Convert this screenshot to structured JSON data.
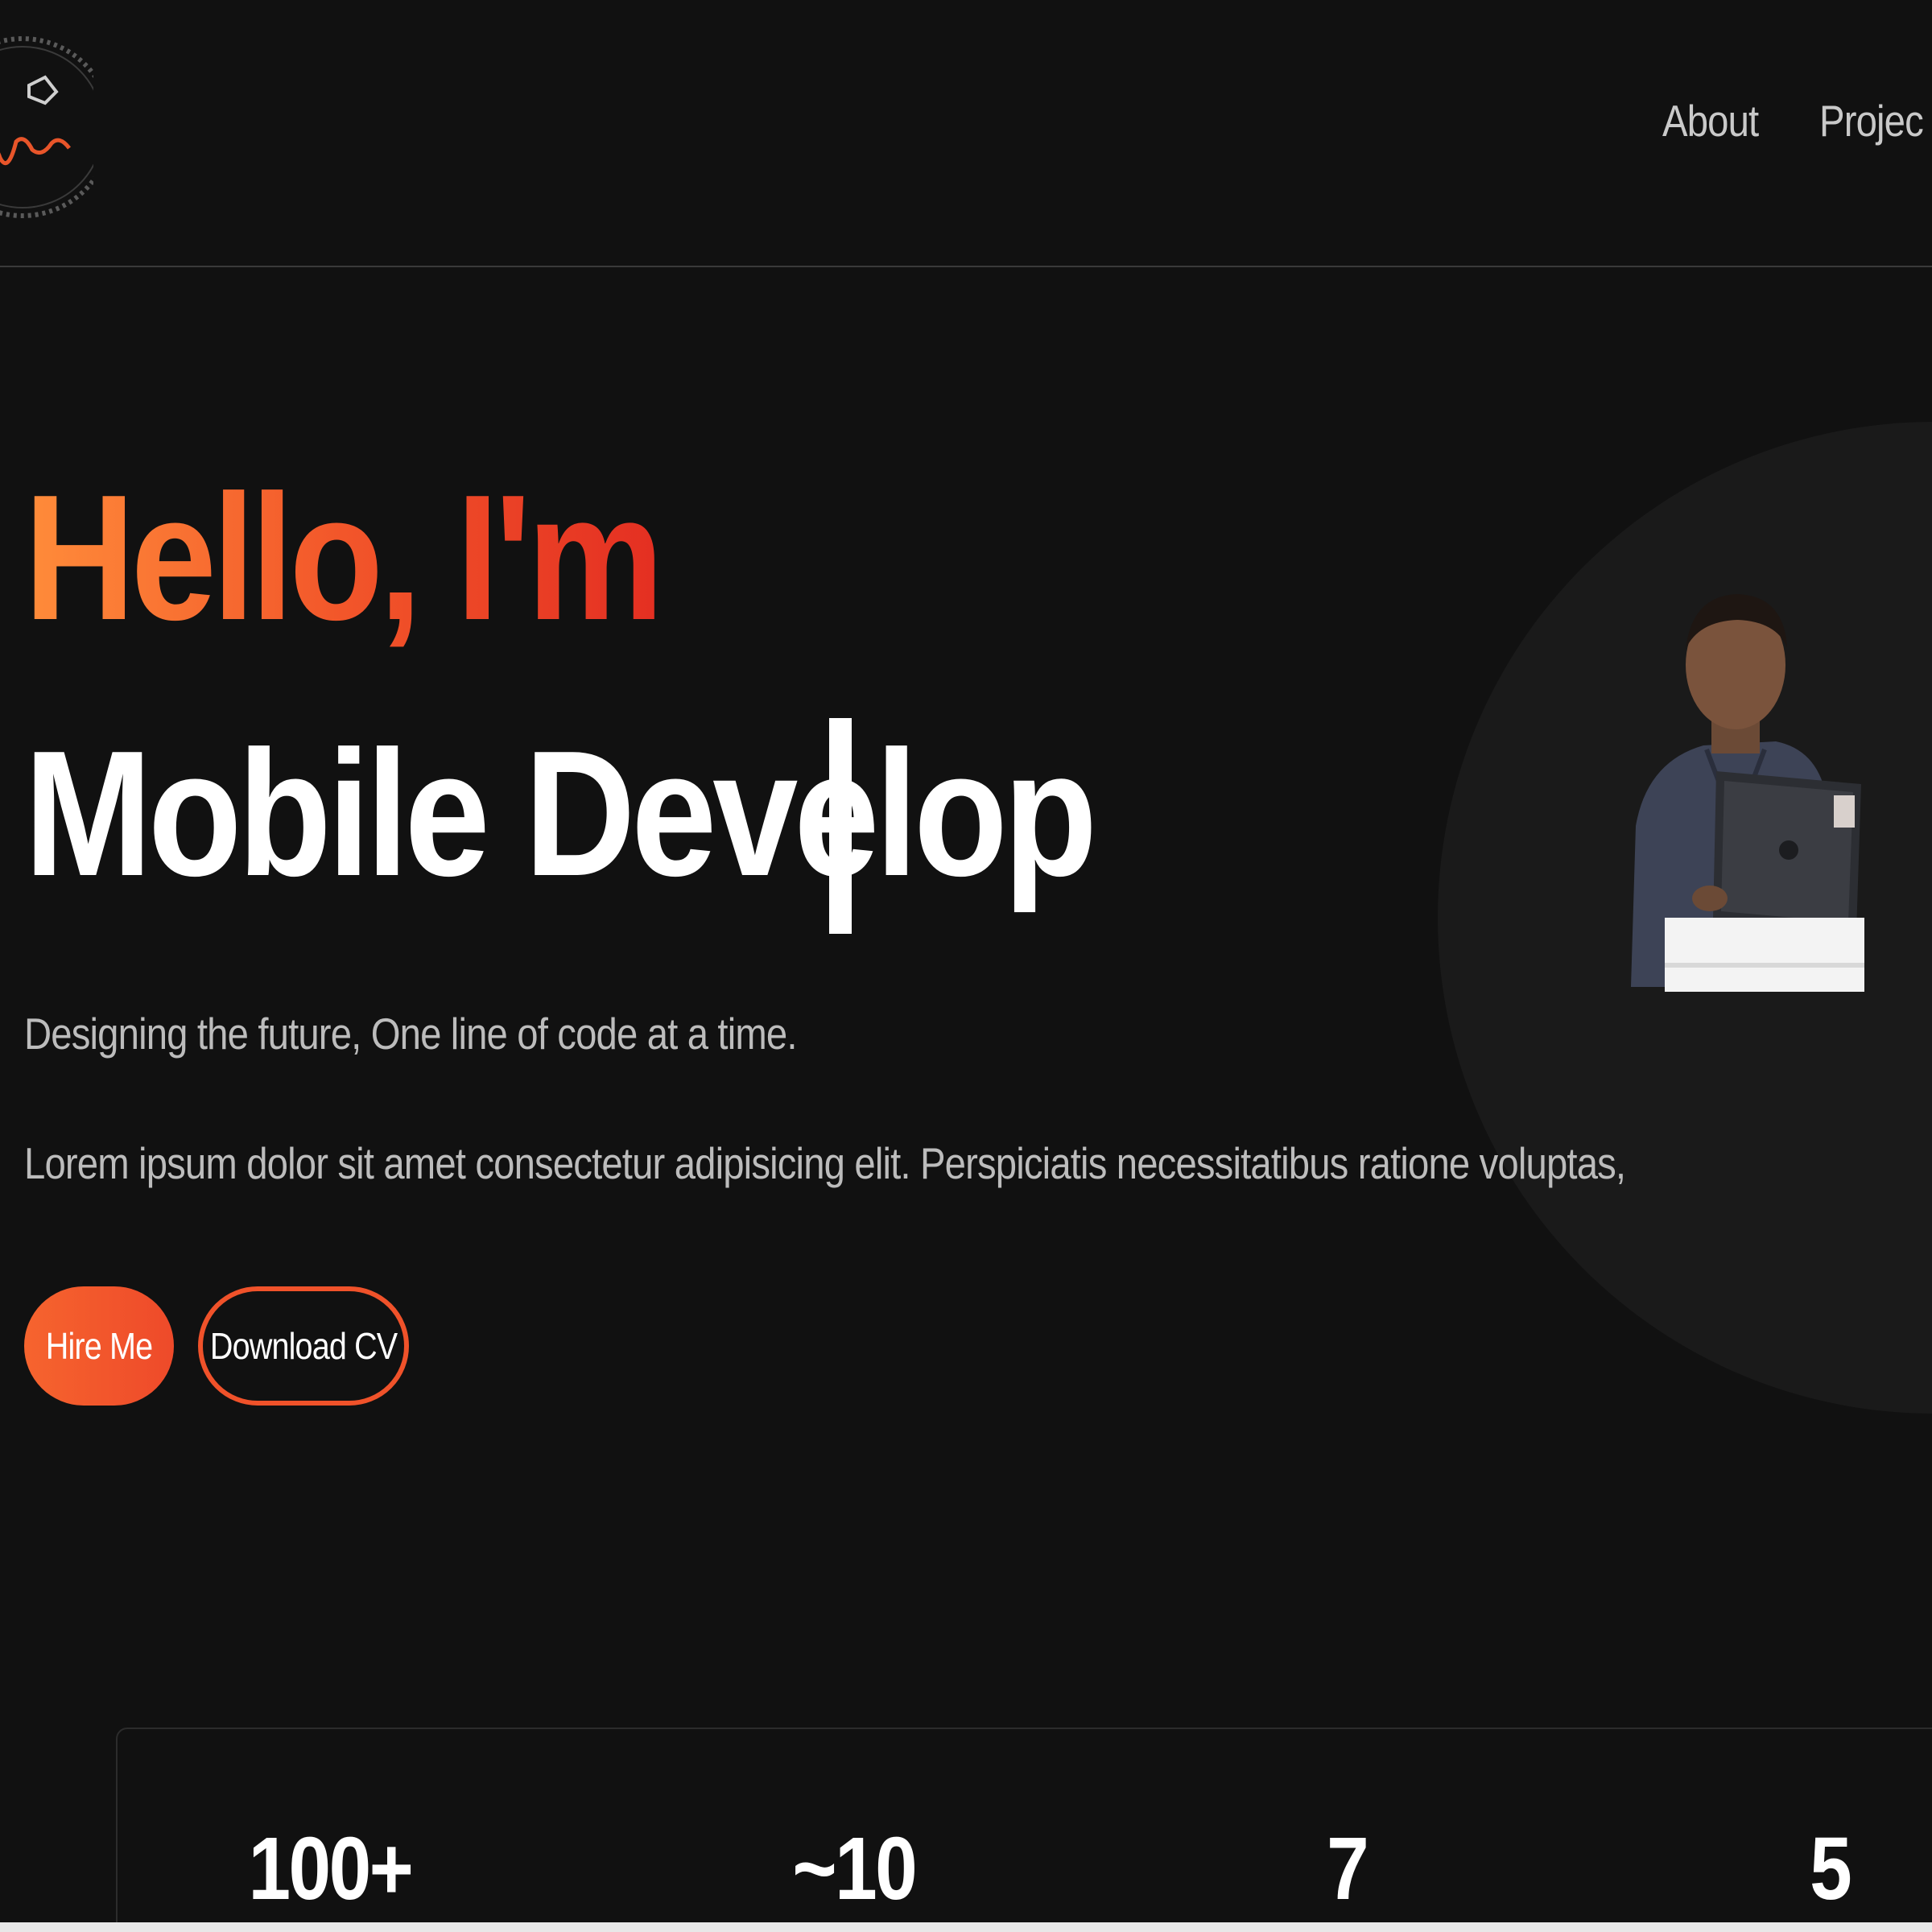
{
  "header": {
    "logo_text": "brightstar",
    "nav": [
      {
        "label": "About"
      },
      {
        "label": "Projec"
      }
    ]
  },
  "hero": {
    "greeting": "Hello, I'm",
    "role": "Mobile Develop",
    "tagline": "Designing the future, One line of code at a time.",
    "description": "Lorem ipsum dolor sit amet consectetur adipisicing elit. Perspiciatis necessitatibus ratione voluptas,",
    "buttons": {
      "hire": "Hire Me",
      "download_cv": "Download CV"
    }
  },
  "stats": [
    {
      "value": "100+"
    },
    {
      "value": "~10"
    },
    {
      "value": "7"
    },
    {
      "value": "5"
    }
  ],
  "colors": {
    "background": "#111111",
    "accent_start": "#ff8c3a",
    "accent_end": "#e42f22",
    "text": "#ffffff",
    "muted_text": "#bcbcbc"
  }
}
